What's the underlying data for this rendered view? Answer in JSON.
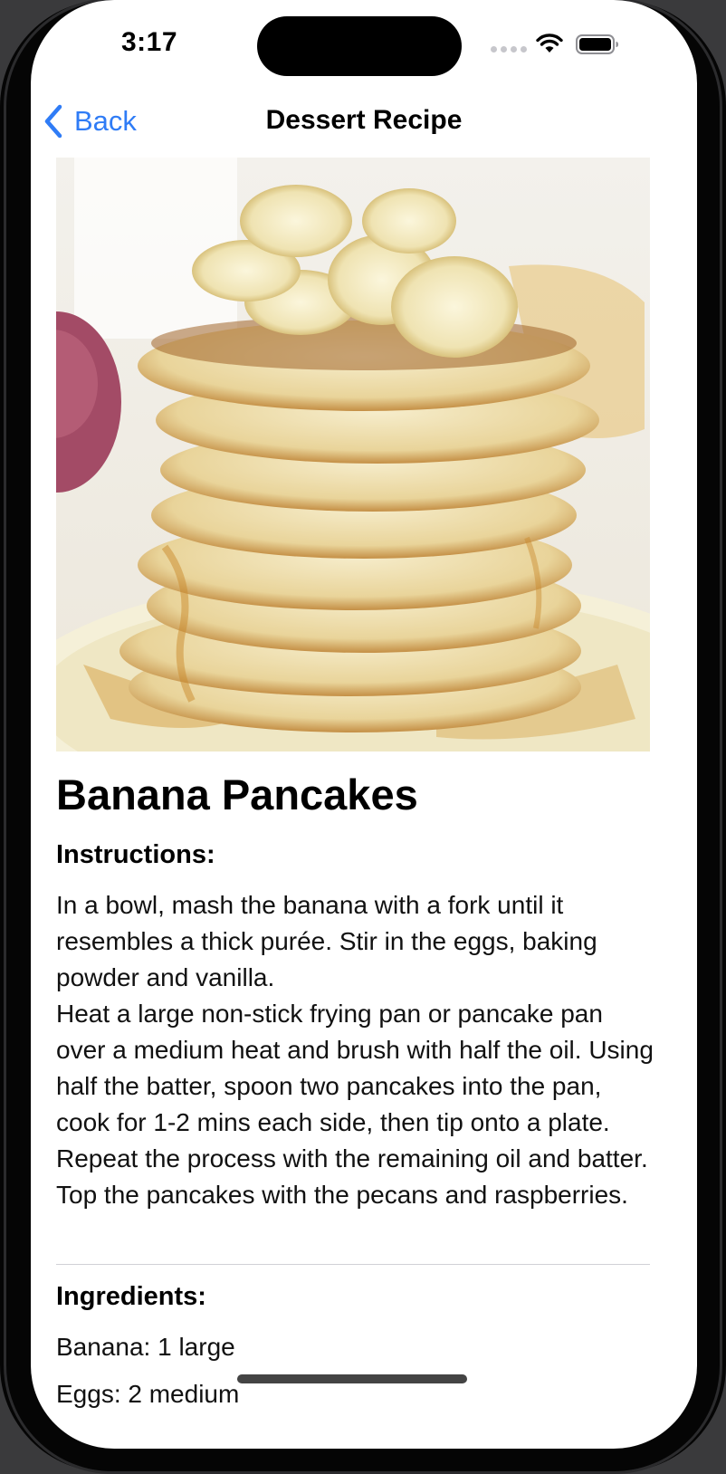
{
  "status_bar": {
    "time": "3:17"
  },
  "nav": {
    "back_label": "Back",
    "title": "Dessert Recipe"
  },
  "recipe": {
    "title": "Banana Pancakes",
    "image_alt": "Stack of banana pancakes with banana slices and syrup",
    "instructions_heading": "Instructions:",
    "instructions": "In a bowl, mash the banana with a fork until it resembles a thick purée. Stir in the eggs, baking powder and vanilla.\nHeat a large non-stick frying pan or pancake pan over a medium heat and brush with half the oil. Using half the batter, spoon two pancakes into the pan, cook for 1-2 mins each side, then tip onto a plate. Repeat the process with the remaining oil and batter. Top the pancakes with the pecans and raspberries.",
    "ingredients_heading": "Ingredients:",
    "ingredients": [
      "Banana: 1 large",
      "Eggs: 2 medium"
    ]
  },
  "colors": {
    "accent": "#2f7cf6",
    "background": "#ffffff",
    "text": "#000000"
  }
}
